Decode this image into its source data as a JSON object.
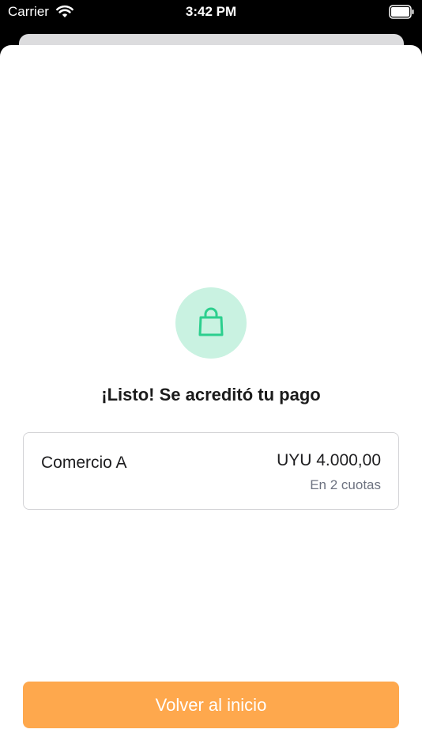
{
  "status_bar": {
    "carrier": "Carrier",
    "time": "3:42 PM"
  },
  "confirmation": {
    "title": "¡Listo! Se acreditó tu pago",
    "icon": "shopping-bag-icon",
    "icon_color": "#2ccf8e",
    "icon_bg": "#c9f2e1"
  },
  "payment": {
    "merchant": "Comercio A",
    "amount": "UYU 4.000,00",
    "installments": "En 2 cuotas"
  },
  "actions": {
    "back_label": "Volver al inicio",
    "back_color": "#fea84d"
  }
}
